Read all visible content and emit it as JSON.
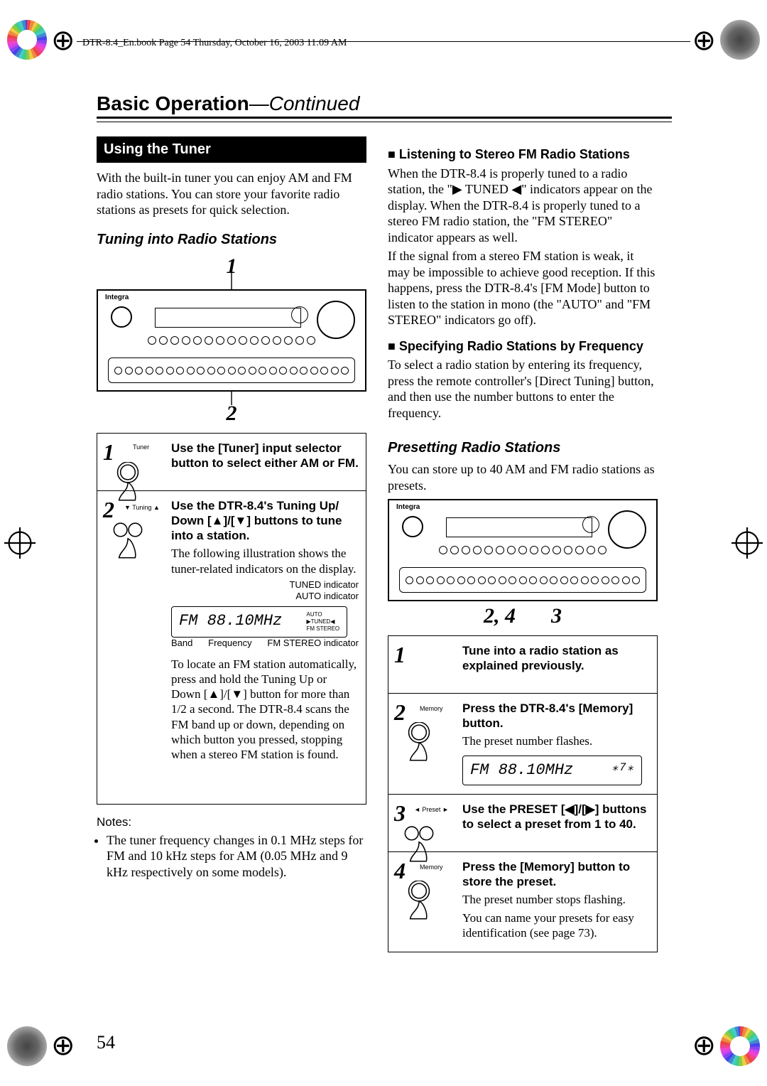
{
  "header_meta": "DTR-8.4_En.book  Page 54  Thursday, October 16, 2003  11:09 AM",
  "heading": {
    "main": "Basic Operation",
    "cont": "—Continued"
  },
  "page_number": "54",
  "left": {
    "titlebar": "Using the Tuner",
    "intro": "With the built-in tuner you can enjoy AM and FM radio stations. You can store your favorite radio stations as presets for quick selection.",
    "sub1": "Tuning into Radio Stations",
    "receiver_brand": "Integra",
    "callout_top": "1",
    "callout_bottom": "2",
    "step1": {
      "num": "1",
      "tuner_label": "Tuner",
      "lead": "Use the [Tuner] input selector button to select either AM or FM."
    },
    "step2": {
      "num": "2",
      "tuning_label": "Tuning",
      "lead_a": "Use the DTR-8.4's Tuning Up/ Down [",
      "lead_b": "]/[",
      "lead_c": "] buttons to tune into a station.",
      "after": "The following illustration shows the tuner-related indicators on the display.",
      "ind_tuned": "TUNED indicator",
      "ind_auto": "AUTO indicator",
      "disp_text": "FM  88.10MHz",
      "lbl_band": "Band",
      "lbl_freq": "Frequency",
      "lbl_fmstereo": "FM STEREO indicator",
      "tail_a": "To locate an FM station automatically, press and hold the Tuning Up or Down [",
      "tail_b": "]/[",
      "tail_c": "] button for more than 1/2 a second. The DTR-8.4 scans the FM band up or down, depending on which button you pressed, stopping when a stereo FM station is found."
    },
    "notes_label": "Notes:",
    "notes_bullet": "The tuner frequency changes in 0.1 MHz steps for FM and 10 kHz steps for AM (0.05 MHz and 9 kHz respectively on some models)."
  },
  "right": {
    "sub_listen": "Listening to Stereo FM Radio Stations",
    "listen_p_a": "When the DTR-8.4 is properly tuned to a radio station, the \"",
    "listen_p_b": " TUNED ",
    "listen_p_c": "\" indicators appear on the display. When the DTR-8.4 is properly tuned to a stereo FM radio station, the \"FM STEREO\" indicator appears as well.",
    "listen_p2": "If the signal from a stereo FM station is weak, it may be impossible to achieve good reception. If this happens, press the DTR-8.4's [FM Mode] button to listen to the station in mono (the \"AUTO\" and \"FM STEREO\" indicators go off).",
    "sub_spec": "Specifying Radio Stations by Frequency",
    "spec_p": "To select a radio station by entering its frequency, press the remote controller's [Direct Tuning] button, and then use the number buttons to enter the frequency.",
    "sub_preset": "Presetting Radio Stations",
    "preset_intro": "You can store up to 40 AM and FM radio stations as presets.",
    "receiver_brand": "Integra",
    "callout_left": "2, 4",
    "callout_right": "3",
    "step1": {
      "num": "1",
      "lead": "Tune into a radio station as explained previously."
    },
    "step2": {
      "num": "2",
      "mem_label": "Memory",
      "lead": "Press the DTR-8.4's [Memory] button.",
      "after": "The preset number flashes.",
      "disp_text": "FM  88.10MHz"
    },
    "step3": {
      "num": "3",
      "preset_label": "Preset",
      "lead_a": "Use the PRESET [",
      "lead_b": "]/[",
      "lead_c": "] buttons to select a preset from 1 to 40."
    },
    "step4": {
      "num": "4",
      "mem_label": "Memory",
      "lead": "Press the [Memory] button to store the preset.",
      "after1": "The preset number stops flashing.",
      "after2": "You can name your presets for easy identification (see page 73)."
    }
  }
}
